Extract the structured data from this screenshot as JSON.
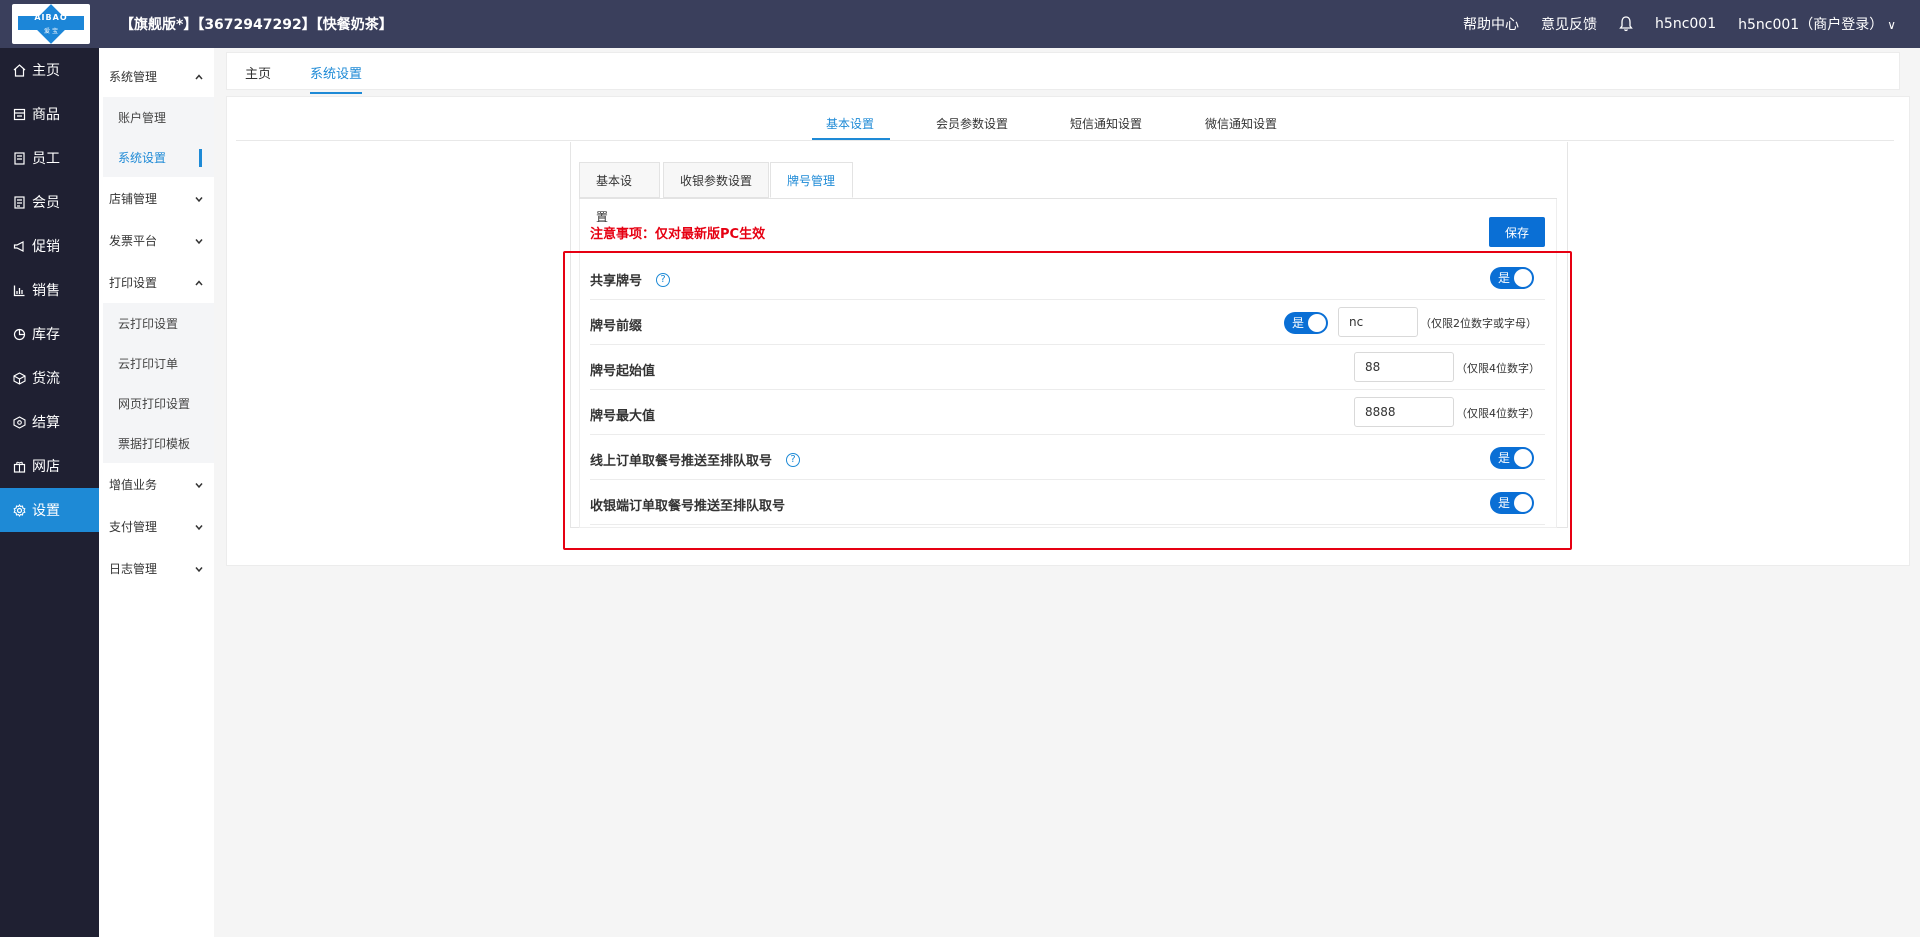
{
  "header": {
    "logo_text": "AIBAO",
    "logo_sub": "爱 宝",
    "store_title": "【旗舰版*】【3672947292】【快餐奶茶】",
    "help_center": "帮助中心",
    "feedback": "意见反馈",
    "user_id": "h5nc001",
    "user_login": "h5nc001（商户登录）"
  },
  "mainnav": [
    {
      "label": "主页",
      "icon": "home-icon"
    },
    {
      "label": "商品",
      "icon": "goods-icon"
    },
    {
      "label": "员工",
      "icon": "staff-icon"
    },
    {
      "label": "会员",
      "icon": "member-icon"
    },
    {
      "label": "促销",
      "icon": "promo-icon"
    },
    {
      "label": "销售",
      "icon": "sales-icon"
    },
    {
      "label": "库存",
      "icon": "stock-icon"
    },
    {
      "label": "货流",
      "icon": "logistics-icon"
    },
    {
      "label": "结算",
      "icon": "settle-icon"
    },
    {
      "label": "网店",
      "icon": "shop-icon"
    },
    {
      "label": "设置",
      "icon": "gear-icon"
    }
  ],
  "subnav": {
    "system_mgmt": "系统管理",
    "account_mgmt": "账户管理",
    "system_settings": "系统设置",
    "store_mgmt": "店铺管理",
    "invoice": "发票平台",
    "print_settings": "打印设置",
    "cloud_print_settings": "云打印设置",
    "cloud_print_orders": "云打印订单",
    "web_print_settings": "网页打印设置",
    "receipt_template": "票据打印模板",
    "value_added": "增值业务",
    "payment_mgmt": "支付管理",
    "log_mgmt": "日志管理"
  },
  "page_tabs": {
    "home": "主页",
    "system_settings": "系统设置"
  },
  "section_tabs": [
    "基本设置",
    "会员参数设置",
    "短信通知设置",
    "微信通知设置"
  ],
  "inner_tabs": [
    "基本设置",
    "收银参数设置",
    "牌号管理"
  ],
  "notice": "注意事项：仅对最新版PC生效",
  "save_label": "保存",
  "toggle_on": "是",
  "rows": {
    "share_number": "共享牌号",
    "prefix": "牌号前缀",
    "prefix_value": "nc",
    "prefix_hint": "（仅限2位数字或字母）",
    "start": "牌号起始值",
    "start_value": "88",
    "start_hint": "（仅限4位数字）",
    "max": "牌号最大值",
    "max_value": "8888",
    "max_hint": "（仅限4位数字）",
    "online_push": "线上订单取餐号推送至排队取号",
    "cashier_push": "收银端订单取餐号推送至排队取号"
  }
}
